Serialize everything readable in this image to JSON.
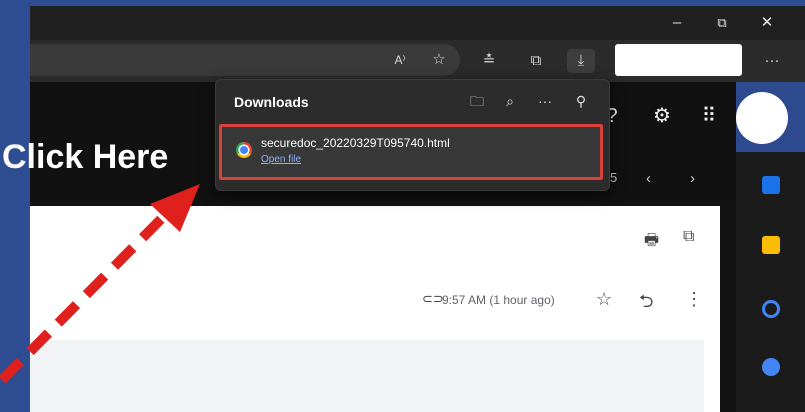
{
  "annotation": {
    "callout_text": "Click Here"
  },
  "window": {
    "minimize": "–",
    "restore": "⧉",
    "close": "✕"
  },
  "toolbar": {
    "icons": [
      "read-aloud-icon",
      "favorite-add-icon",
      "favorites-icon",
      "collections-icon",
      "downloads-icon",
      "more-icon"
    ],
    "more_label": "···"
  },
  "downloads": {
    "title": "Downloads",
    "item": {
      "filename": "securedoc_20220329T095740.html",
      "action": "Open file"
    }
  },
  "mail": {
    "pager": "5",
    "time": "9:57 AM (1 hour ago)"
  },
  "colors": {
    "highlight": "#d9403a",
    "link": "#8ab4f8",
    "slide_bg": "#2f4d93"
  }
}
